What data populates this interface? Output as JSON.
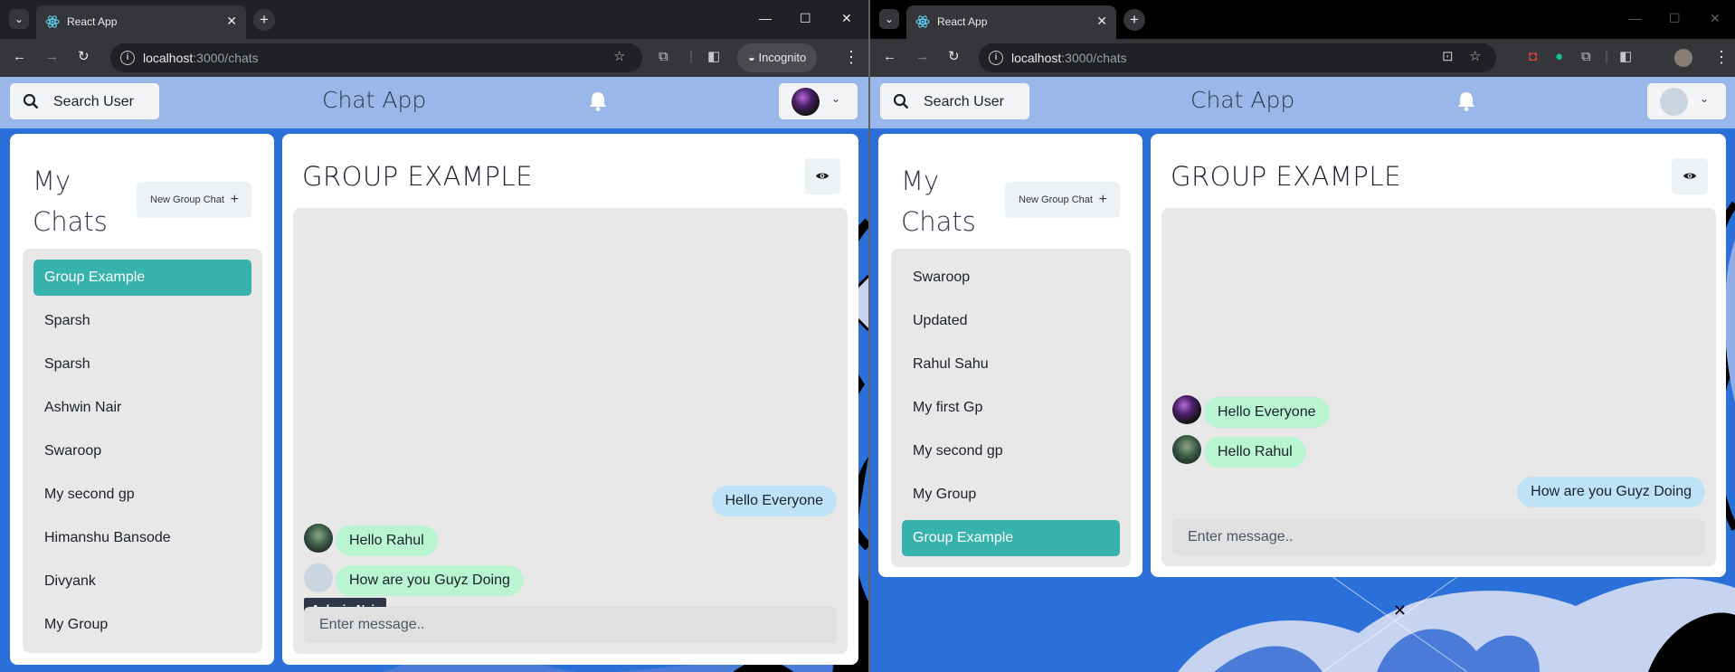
{
  "windows": [
    {
      "browser": {
        "tab_title": "React App",
        "url_host": "localhost",
        "url_path": ":3000/chats",
        "incognito_label": "Incognito"
      },
      "header": {
        "search_label": "Search User",
        "title": "Chat App",
        "avatar": "user-avatar-photo"
      },
      "chats": {
        "heading_line1": "My",
        "heading_line2": "Chats",
        "new_group_label": "New Group Chat",
        "items": [
          {
            "label": "Group Example",
            "active": true
          },
          {
            "label": "Sparsh",
            "active": false
          },
          {
            "label": "Sparsh",
            "active": false
          },
          {
            "label": "Ashwin Nair",
            "active": false
          },
          {
            "label": "Swaroop",
            "active": false
          },
          {
            "label": "My second gp",
            "active": false
          },
          {
            "label": "Himanshu Bansode",
            "active": false
          },
          {
            "label": "Divyank",
            "active": false
          },
          {
            "label": "My Group",
            "active": false
          }
        ]
      },
      "conversation": {
        "title": "GROUP EXAMPLE",
        "messages": [
          {
            "text": "Hello Everyone",
            "mine": true
          },
          {
            "text": "Hello Rahul",
            "mine": false,
            "avatar": "photo-green"
          },
          {
            "text": "How are you Guyz Doing",
            "mine": false,
            "avatar": "default"
          }
        ],
        "tooltip": "Ashwin Nair",
        "input_placeholder": "Enter message.."
      }
    },
    {
      "browser": {
        "tab_title": "React App",
        "url_host": "localhost",
        "url_path": ":3000/chats"
      },
      "header": {
        "search_label": "Search User",
        "title": "Chat App",
        "avatar": "default-avatar"
      },
      "chats": {
        "heading_line1": "My",
        "heading_line2": "Chats",
        "new_group_label": "New Group Chat",
        "items": [
          {
            "label": "Swaroop",
            "active": false
          },
          {
            "label": "Updated",
            "active": false
          },
          {
            "label": "Rahul Sahu",
            "active": false
          },
          {
            "label": "My first Gp",
            "active": false
          },
          {
            "label": "My second gp",
            "active": false
          },
          {
            "label": "My Group",
            "active": false
          },
          {
            "label": "Group Example",
            "active": true
          }
        ]
      },
      "conversation": {
        "title": "GROUP EXAMPLE",
        "messages": [
          {
            "text": "Hello Everyone",
            "mine": false,
            "avatar": "photo-purple"
          },
          {
            "text": "Hello Rahul",
            "mine": false,
            "avatar": "photo-green"
          },
          {
            "text": "How are you Guyz Doing",
            "mine": true
          }
        ],
        "input_placeholder": "Enter message.."
      }
    }
  ],
  "colors": {
    "header_bg": "#9ab7ea",
    "active_chat": "#38b2ac",
    "bubble_mine": "#bee3f8",
    "bubble_theirs": "#b9f5d0"
  }
}
